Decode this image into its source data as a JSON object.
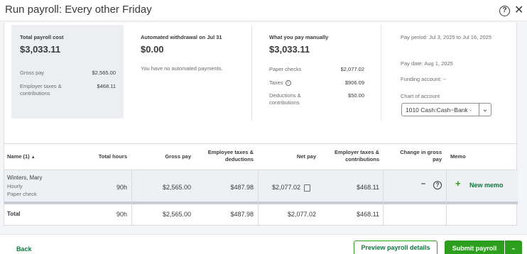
{
  "header": {
    "title": "Run payroll: Every other Friday",
    "help_glyph": "?",
    "close_glyph": "✕"
  },
  "summary": {
    "total_cost": {
      "label": "Total payroll cost",
      "amount": "$3,033.11",
      "rows": [
        {
          "label": "Gross pay",
          "value": "$2,565.00"
        },
        {
          "label": "Employer taxes & contributions",
          "value": "$468.11"
        }
      ]
    },
    "withdrawal": {
      "label": "Automated withdrawal on Jul 31",
      "amount": "$0.00",
      "note": "You have no automated payments."
    },
    "manual": {
      "label": "What you pay manually",
      "amount": "$3,033.11",
      "rows": [
        {
          "label": "Paper checks",
          "value": "$2,077.02"
        },
        {
          "label": "Taxes",
          "value": "$906.09"
        },
        {
          "label": "Deductions & contributions",
          "value": "$50.00"
        }
      ]
    },
    "period": {
      "pay_period": "Pay period: Jul 3, 2025 to Jul 16, 2025",
      "pay_date": "Pay date: Aug 1, 2025",
      "funding": "Funding account: --",
      "chart_label": "Chart of account",
      "chart_value": "1010 Cash:Cash~Bank -"
    }
  },
  "table": {
    "headers": {
      "name": "Name (1)",
      "sort_glyph": "▲",
      "hours": "Total hours",
      "gross": "Gross pay",
      "emp_taxes": "Employee taxes & deductions",
      "net": "Net pay",
      "employer_taxes": "Employer taxes & contributions",
      "change": "Change in gross pay",
      "memo": "Memo"
    },
    "row": {
      "name": "Winters, Mary",
      "type": "Hourly",
      "method": "Paper check",
      "hours": "90h",
      "gross": "$2,565.00",
      "emp_taxes": "$487.98",
      "net": "$2,077.02",
      "employer_taxes": "$468.11",
      "change": "–",
      "memo_link": "New memo"
    },
    "total": {
      "label": "Total",
      "hours": "90h",
      "gross": "$2,565.00",
      "emp_taxes": "$487.98",
      "net": "$2,077.02",
      "employer_taxes": "$468.11"
    }
  },
  "footer": {
    "back": "Back",
    "preview": "Preview payroll details",
    "submit": "Submit payroll"
  }
}
